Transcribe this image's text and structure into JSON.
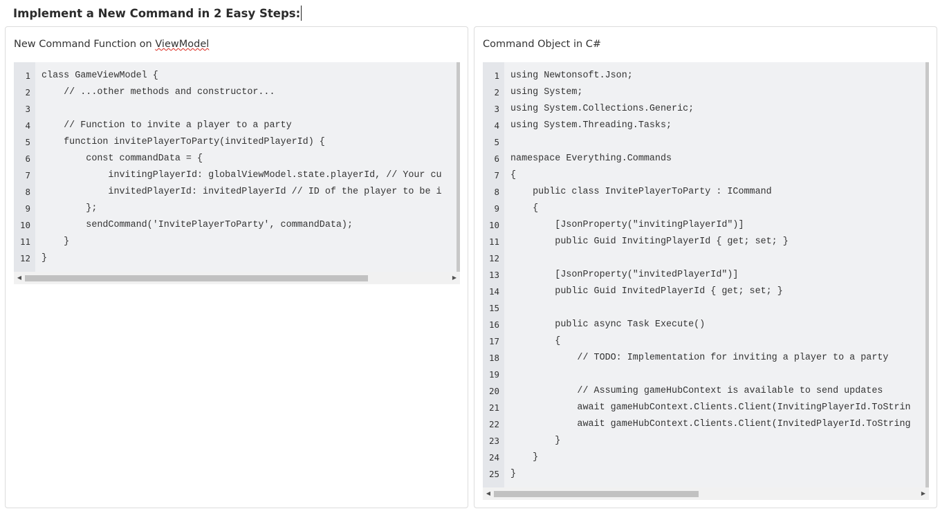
{
  "page": {
    "title": "Implement a New Command in 2 Easy Steps:"
  },
  "left_panel": {
    "title_prefix": "New Command Function on ",
    "title_word": "ViewModel",
    "lines": [
      {
        "n": "1",
        "code": "class GameViewModel {"
      },
      {
        "n": "2",
        "code": "    // ...other methods and constructor..."
      },
      {
        "n": "3",
        "code": ""
      },
      {
        "n": "4",
        "code": "    // Function to invite a player to a party"
      },
      {
        "n": "5",
        "code": "    function invitePlayerToParty(invitedPlayerId) {"
      },
      {
        "n": "6",
        "code": "        const commandData = {"
      },
      {
        "n": "7",
        "code": "            invitingPlayerId: globalViewModel.state.playerId, // Your cu"
      },
      {
        "n": "8",
        "code": "            invitedPlayerId: invitedPlayerId // ID of the player to be i"
      },
      {
        "n": "9",
        "code": "        };"
      },
      {
        "n": "10",
        "code": "        sendCommand('InvitePlayerToParty', commandData);"
      },
      {
        "n": "11",
        "code": "    }"
      },
      {
        "n": "12",
        "code": "}"
      }
    ]
  },
  "right_panel": {
    "title": "Command Object in C#",
    "lines": [
      {
        "n": "1",
        "code": "using Newtonsoft.Json;"
      },
      {
        "n": "2",
        "code": "using System;"
      },
      {
        "n": "3",
        "code": "using System.Collections.Generic;"
      },
      {
        "n": "4",
        "code": "using System.Threading.Tasks;"
      },
      {
        "n": "5",
        "code": ""
      },
      {
        "n": "6",
        "code": "namespace Everything.Commands"
      },
      {
        "n": "7",
        "code": "{"
      },
      {
        "n": "8",
        "code": "    public class InvitePlayerToParty : ICommand"
      },
      {
        "n": "9",
        "code": "    {"
      },
      {
        "n": "10",
        "code": "        [JsonProperty(\"invitingPlayerId\")]"
      },
      {
        "n": "11",
        "code": "        public Guid InvitingPlayerId { get; set; }"
      },
      {
        "n": "12",
        "code": ""
      },
      {
        "n": "13",
        "code": "        [JsonProperty(\"invitedPlayerId\")]"
      },
      {
        "n": "14",
        "code": "        public Guid InvitedPlayerId { get; set; }"
      },
      {
        "n": "15",
        "code": ""
      },
      {
        "n": "16",
        "code": "        public async Task Execute()"
      },
      {
        "n": "17",
        "code": "        {"
      },
      {
        "n": "18",
        "code": "            // TODO: Implementation for inviting a player to a party"
      },
      {
        "n": "19",
        "code": ""
      },
      {
        "n": "20",
        "code": "            // Assuming gameHubContext is available to send updates"
      },
      {
        "n": "21",
        "code": "            await gameHubContext.Clients.Client(InvitingPlayerId.ToStrin"
      },
      {
        "n": "22",
        "code": "            await gameHubContext.Clients.Client(InvitedPlayerId.ToString"
      },
      {
        "n": "23",
        "code": "        }"
      },
      {
        "n": "24",
        "code": "    }"
      },
      {
        "n": "25",
        "code": "}"
      }
    ]
  },
  "icons": {
    "scroll_left": "◀",
    "scroll_right": "▶"
  }
}
